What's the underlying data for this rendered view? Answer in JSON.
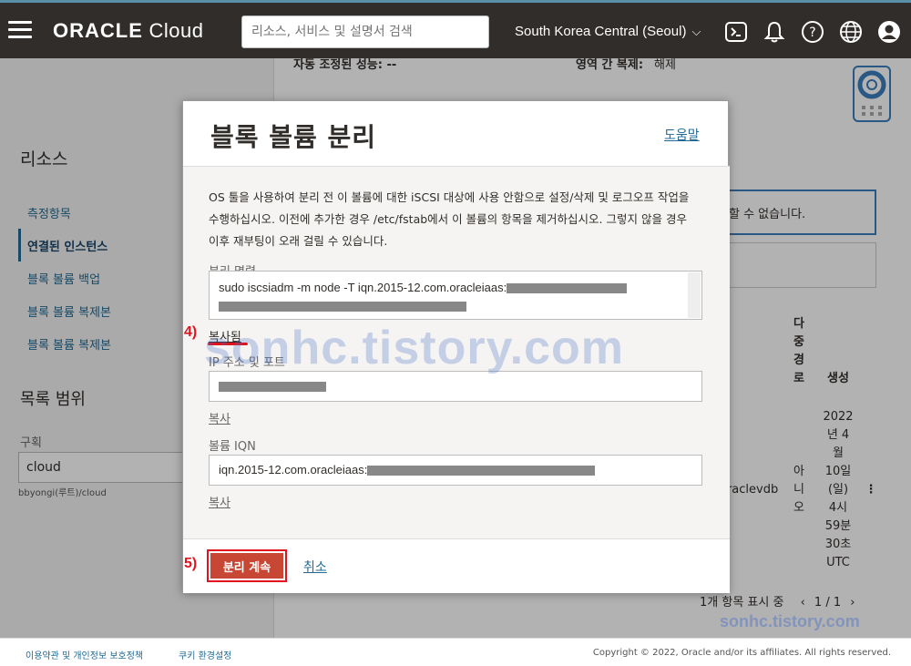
{
  "topbar": {
    "brand_bold": "ORACLE",
    "brand_light": " Cloud",
    "search_placeholder": "리소스, 서비스 및 설명서 검색",
    "region": "South Korea Central (Seoul)"
  },
  "sidebar": {
    "resources_title": "리소스",
    "items": [
      {
        "label": "측정항목"
      },
      {
        "label": "연결된 인스턴스"
      },
      {
        "label": "블록 볼륨 백업"
      },
      {
        "label": "블록 볼륨 복제본"
      },
      {
        "label": "블록 볼륨 복제본"
      }
    ],
    "scope_title": "목록 범위",
    "compartment_label": "구획",
    "compartment_value": "cloud",
    "compartment_path": "bbyongi(루트)/cloud"
  },
  "background": {
    "autotune_label": "자동 조정된 성능: --",
    "cross_region_label": "영역 간 복제:",
    "cross_region_value": "해제",
    "alert_text": "할 수 없습니다.",
    "col_multipath": [
      "다",
      "중",
      "경",
      "로"
    ],
    "col_created": "생성",
    "row_name": "oraclevdb",
    "row_multipath": [
      "아",
      "니",
      "오"
    ],
    "row_created": [
      "2022",
      "년 4",
      "월",
      "10일",
      "(일)",
      "4시",
      "59분",
      "30초",
      "UTC"
    ],
    "pager_text": "1개 항목 표시 중",
    "pager_pages": "1 / 1"
  },
  "dialog": {
    "title": "블록 볼륨 분리",
    "help_link": "도움말",
    "description": "OS 툴을 사용하여 분리 전 이 볼륨에 대한 iSCSI 대상에 사용 안함으로 설정/삭제 및 로그오프 작업을 수행하십시오. 이전에 추가한 경우 /etc/fstab에서 이 볼륨의 항목을 제거하십시오. 그렇지 않을 경우 이후 재부팅이 오래 걸릴 수 있습니다.",
    "detach_cmd_label": "분리 명령",
    "detach_cmd_value": "sudo iscsiadm -m node -T iqn.2015-12.com.oracleiaas:",
    "copied_label": "복사됨",
    "ip_port_label": "IP 주소 및 포트",
    "copy_label_1": "복사",
    "iqn_label": "볼륨 IQN",
    "iqn_value": "iqn.2015-12.com.oracleiaas:",
    "copy_label_2": "복사",
    "continue_button": "분리 계속",
    "cancel_link": "취소"
  },
  "annotations": {
    "step4": "4)",
    "step5": "5)",
    "watermark": "sonhc.tistory.com",
    "watermark_small": "sonhc.tistory.com"
  },
  "footer": {
    "terms_link": "이용약관 및 개인정보 보호정책",
    "cookie_link": "쿠키 환경설정",
    "copyright": "Copyright © 2022, Oracle and/or its affiliates. All rights reserved."
  },
  "colors": {
    "topbar": "#312d2a",
    "accent_red": "#e1141e",
    "primary_button": "#c74634",
    "link": "#216a94"
  }
}
